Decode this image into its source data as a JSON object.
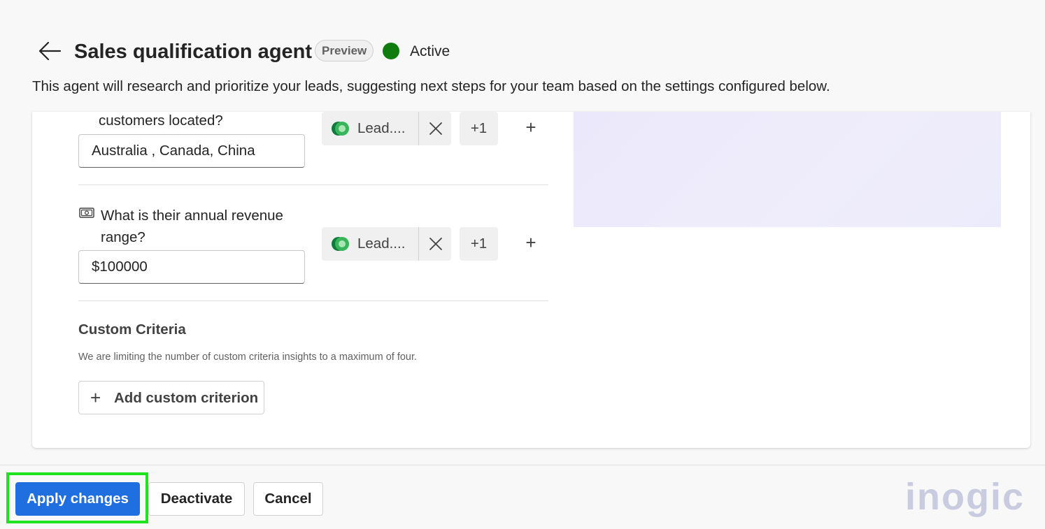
{
  "header": {
    "title": "Sales qualification agent",
    "badge": "Preview",
    "status": "Active",
    "status_color": "#107c10",
    "description": "This agent will research and prioritize your leads, suggesting next steps for your team based on the settings configured below."
  },
  "questions": [
    {
      "text": "customers located?",
      "value": "Australia , Canada, China",
      "chip_label": "Lead....",
      "more": "+1"
    },
    {
      "text_line1": "What is their annual revenue",
      "text_line2": "range?",
      "icon": "money-icon",
      "value": "$100000",
      "chip_label": "Lead....",
      "more": "+1"
    }
  ],
  "custom_criteria": {
    "title": "Custom Criteria",
    "note": "We are limiting the number of custom criteria insights to a maximum of four.",
    "add_label": "Add custom criterion"
  },
  "footer": {
    "apply": "Apply changes",
    "deactivate": "Deactivate",
    "cancel": "Cancel",
    "primary_color": "#1f6fe0",
    "highlight_color": "#1ee31e"
  },
  "watermark": "inogic"
}
